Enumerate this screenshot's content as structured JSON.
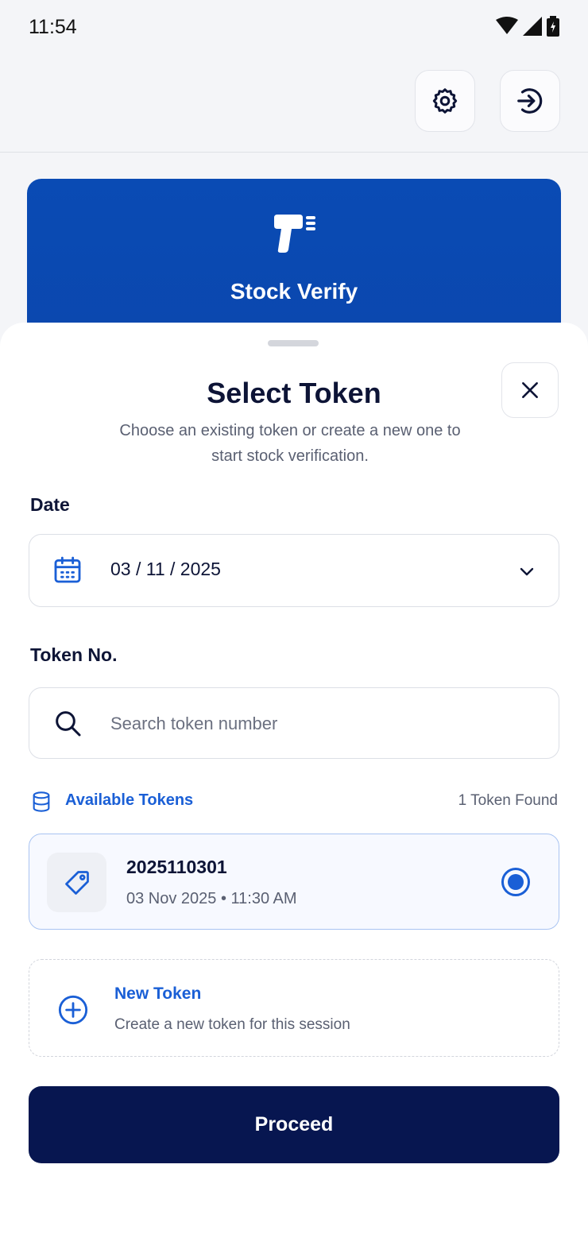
{
  "status_bar": {
    "time": "11:54",
    "icons": [
      "wifi-icon",
      "signal-icon",
      "battery-icon"
    ]
  },
  "top_bar": {
    "settings_icon": "gear-icon",
    "logout_icon": "login-arrow-icon"
  },
  "hero": {
    "title": "Stock Verify",
    "icon": "barcode-scanner-icon"
  },
  "sheet": {
    "title": "Select Token",
    "subtitle": "Choose an existing token or create a new one to start stock verification.",
    "close_icon": "close-icon",
    "date_label": "Date",
    "date_value": "03 / 11 / 2025",
    "token_label": "Token No.",
    "search_placeholder": "Search token number",
    "available_label": "Available Tokens",
    "available_count": "1 Token Found",
    "tokens": [
      {
        "number": "2025110301",
        "meta": "03 Nov 2025 • 11:30 AM",
        "selected": true
      }
    ],
    "new_token_title": "New Token",
    "new_token_subtitle": "Create a new token for this session",
    "proceed_label": "Proceed"
  },
  "colors": {
    "accent": "#1a5fd6",
    "hero": "#0a4bb4",
    "primary_button": "#071650"
  }
}
